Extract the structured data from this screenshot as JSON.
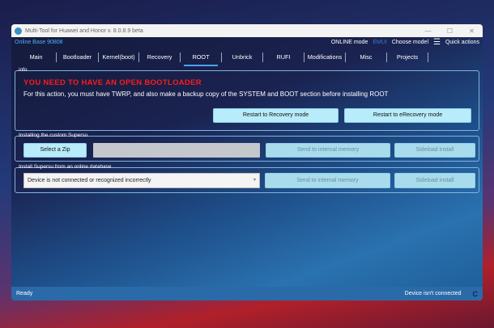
{
  "window": {
    "title": "Multi-Tool for Huawei and Honor v. 8.0.8.9 beta",
    "minimize": "—",
    "maximize": "☐",
    "close": "✕"
  },
  "infobar": {
    "base": "Online Base 90808",
    "mode": "ONLINE mode",
    "emui": "EMUI",
    "choose_model": "Choose model",
    "menu_icon": "☰",
    "quick_actions": "Quick actions"
  },
  "tabs": [
    {
      "label": "Main"
    },
    {
      "label": "Bootloader"
    },
    {
      "label": "Kernel(boot)"
    },
    {
      "label": "Recovery"
    },
    {
      "label": "ROOT",
      "active": true
    },
    {
      "label": "Unbrick"
    },
    {
      "label": "RUFI"
    },
    {
      "label": "Modifications"
    },
    {
      "label": "Misc"
    },
    {
      "label": "Projects"
    }
  ],
  "info": {
    "label": "info",
    "warning": "YOU NEED TO HAVE AN OPEN BOOTLOADER",
    "message": "For this action, you must have TWRP, and also make a backup copy of the SYSTEM and BOOT section before installing ROOT",
    "btn_recovery": "Restart to Recovery mode",
    "btn_erecovery": "Restart to eRecovery mode"
  },
  "custom": {
    "label": "Installing the custom Supersu",
    "select_zip": "Select a Zip",
    "path_value": "",
    "send": "Send to internal memory",
    "sideload": "Sideload install"
  },
  "online": {
    "label": "Install Supersu from an online database",
    "select_value": "Device is not connected or recognized incorrectly",
    "send": "Send to internal memory",
    "sideload": "Sideload install"
  },
  "status": {
    "left": "Ready",
    "right": "Device isn't connected",
    "refresh_icon": "C"
  }
}
